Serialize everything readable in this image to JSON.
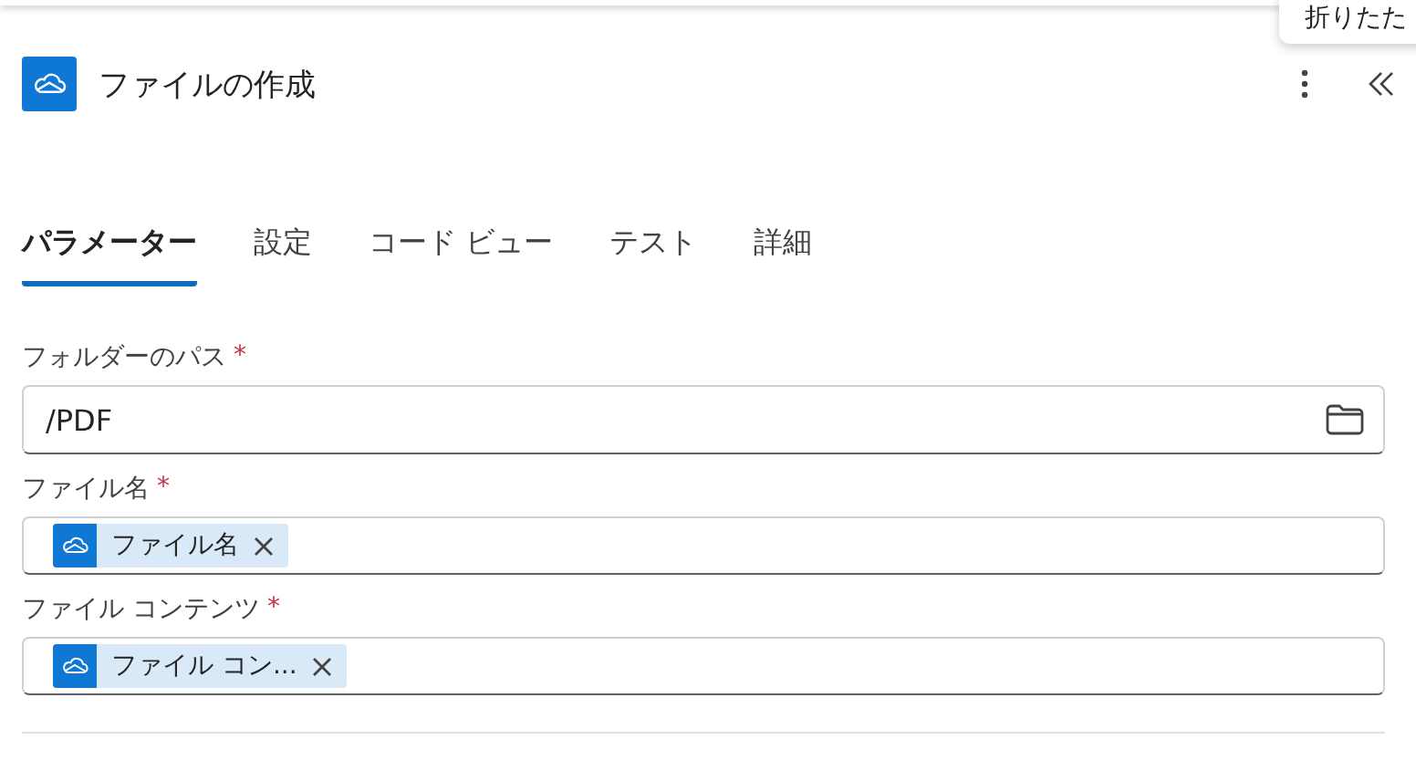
{
  "tooltip": {
    "text": "折りたた"
  },
  "header": {
    "title": "ファイルの作成"
  },
  "tabs": [
    {
      "label": "パラメーター",
      "selected": true
    },
    {
      "label": "設定",
      "selected": false
    },
    {
      "label": "コード ビュー",
      "selected": false
    },
    {
      "label": "テスト",
      "selected": false
    },
    {
      "label": "詳細",
      "selected": false
    }
  ],
  "fields": [
    {
      "label": "フォルダーのパス",
      "required_mark": "*",
      "kind": "text",
      "value": "/PDF"
    },
    {
      "label": "ファイル名",
      "required_mark": "*",
      "kind": "tokens",
      "tokens": [
        {
          "label": "ファイル名"
        }
      ]
    },
    {
      "label": "ファイル コンテンツ",
      "required_mark": "*",
      "kind": "tokens",
      "tokens": [
        {
          "label": "ファイル コン..."
        }
      ]
    }
  ]
}
